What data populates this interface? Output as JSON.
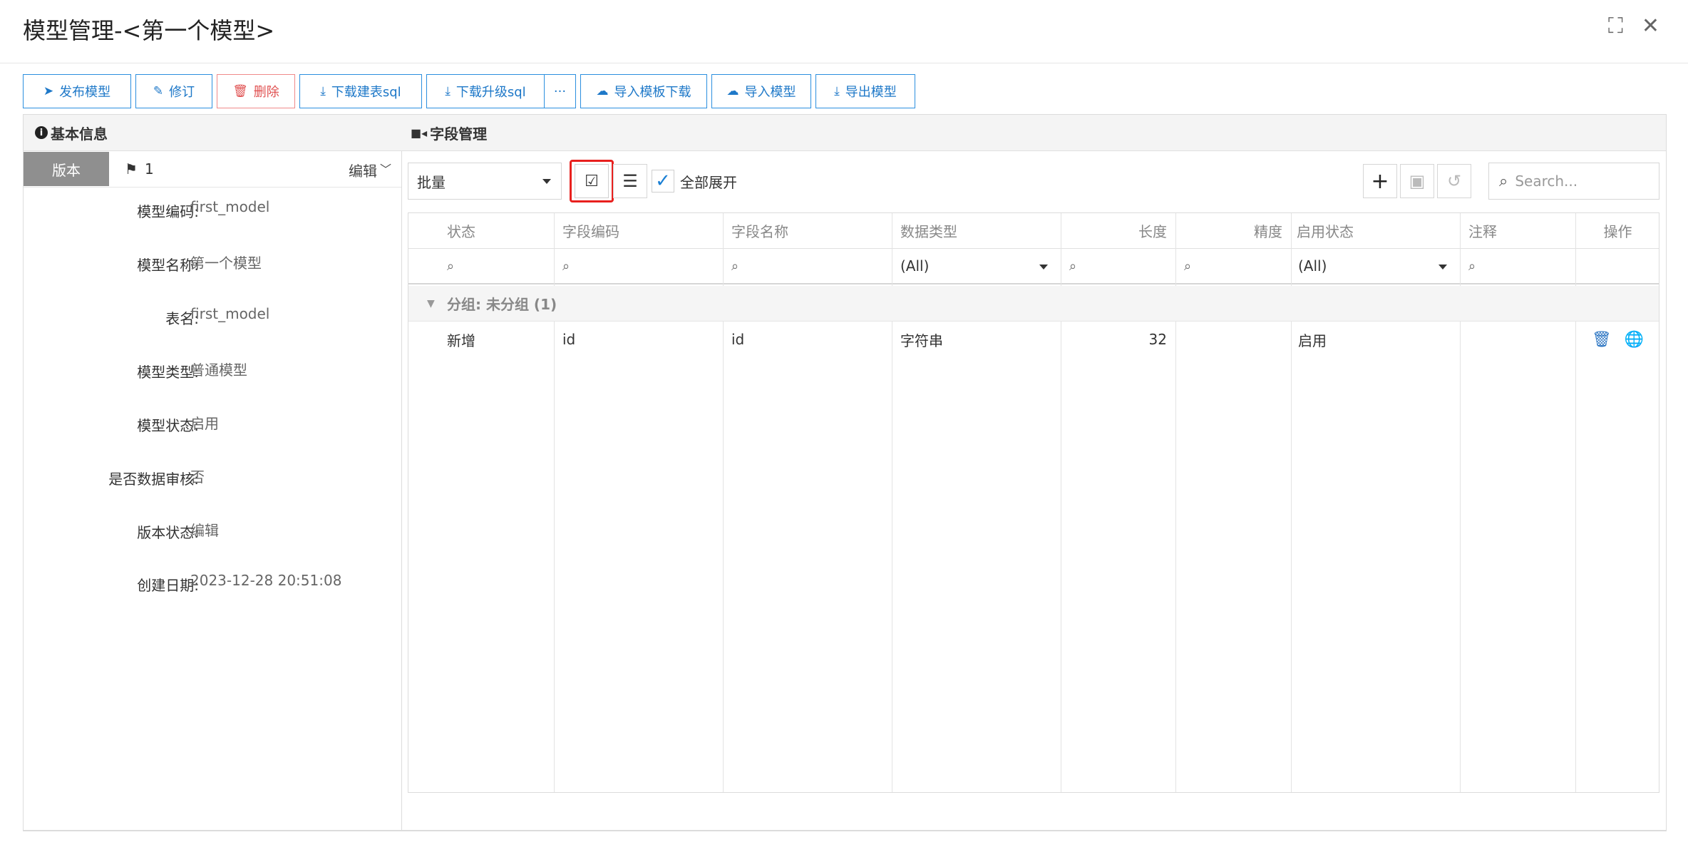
{
  "window": {
    "title": "模型管理-<第一个模型>",
    "maximize_icon": "maximize-icon",
    "close_icon": "close-icon"
  },
  "toolbar": {
    "publish": "发布模型",
    "revise": "修订",
    "delete": "删除",
    "download_create_sql": "下载建表sql",
    "download_upgrade_sql": "下载升级sql",
    "more": "···",
    "import_template": "导入模板下载",
    "import_model": "导入模型",
    "export_model": "导出模型"
  },
  "basic_info": {
    "title": "基本信息",
    "version_tab": "版本",
    "version_number": "1",
    "edit_label": "编辑",
    "fields": [
      {
        "label": "模型编码:",
        "value": "first_model"
      },
      {
        "label": "模型名称:",
        "value": "第一个模型"
      },
      {
        "label": "表名:",
        "value": "first_model"
      },
      {
        "label": "模型类型:",
        "value": "普通模型"
      },
      {
        "label": "模型状态:",
        "value": "启用"
      },
      {
        "label": "是否数据审核:",
        "value": "否"
      },
      {
        "label": "版本状态:",
        "value": "编辑"
      },
      {
        "label": "创建日期:",
        "value": "2023-12-28 20:51:08"
      }
    ]
  },
  "field_mgmt": {
    "title": "字段管理",
    "batch_select": "批量",
    "expand_all": "全部展开",
    "search_placeholder": "Search...",
    "columns": [
      "状态",
      "字段编码",
      "字段名称",
      "数据类型",
      "长度",
      "精度",
      "启用状态",
      "注释",
      "操作"
    ],
    "filter_all": "(All)",
    "group_label": "分组: 未分组 (1)",
    "rows": [
      {
        "status": "新增",
        "code": "id",
        "name": "id",
        "type": "字符串",
        "length": "32",
        "precision": "",
        "enabled": "启用",
        "comment": ""
      }
    ]
  },
  "colors": {
    "accent": "#1e78c8",
    "danger": "#e05050",
    "highlight": "#e8201e"
  }
}
